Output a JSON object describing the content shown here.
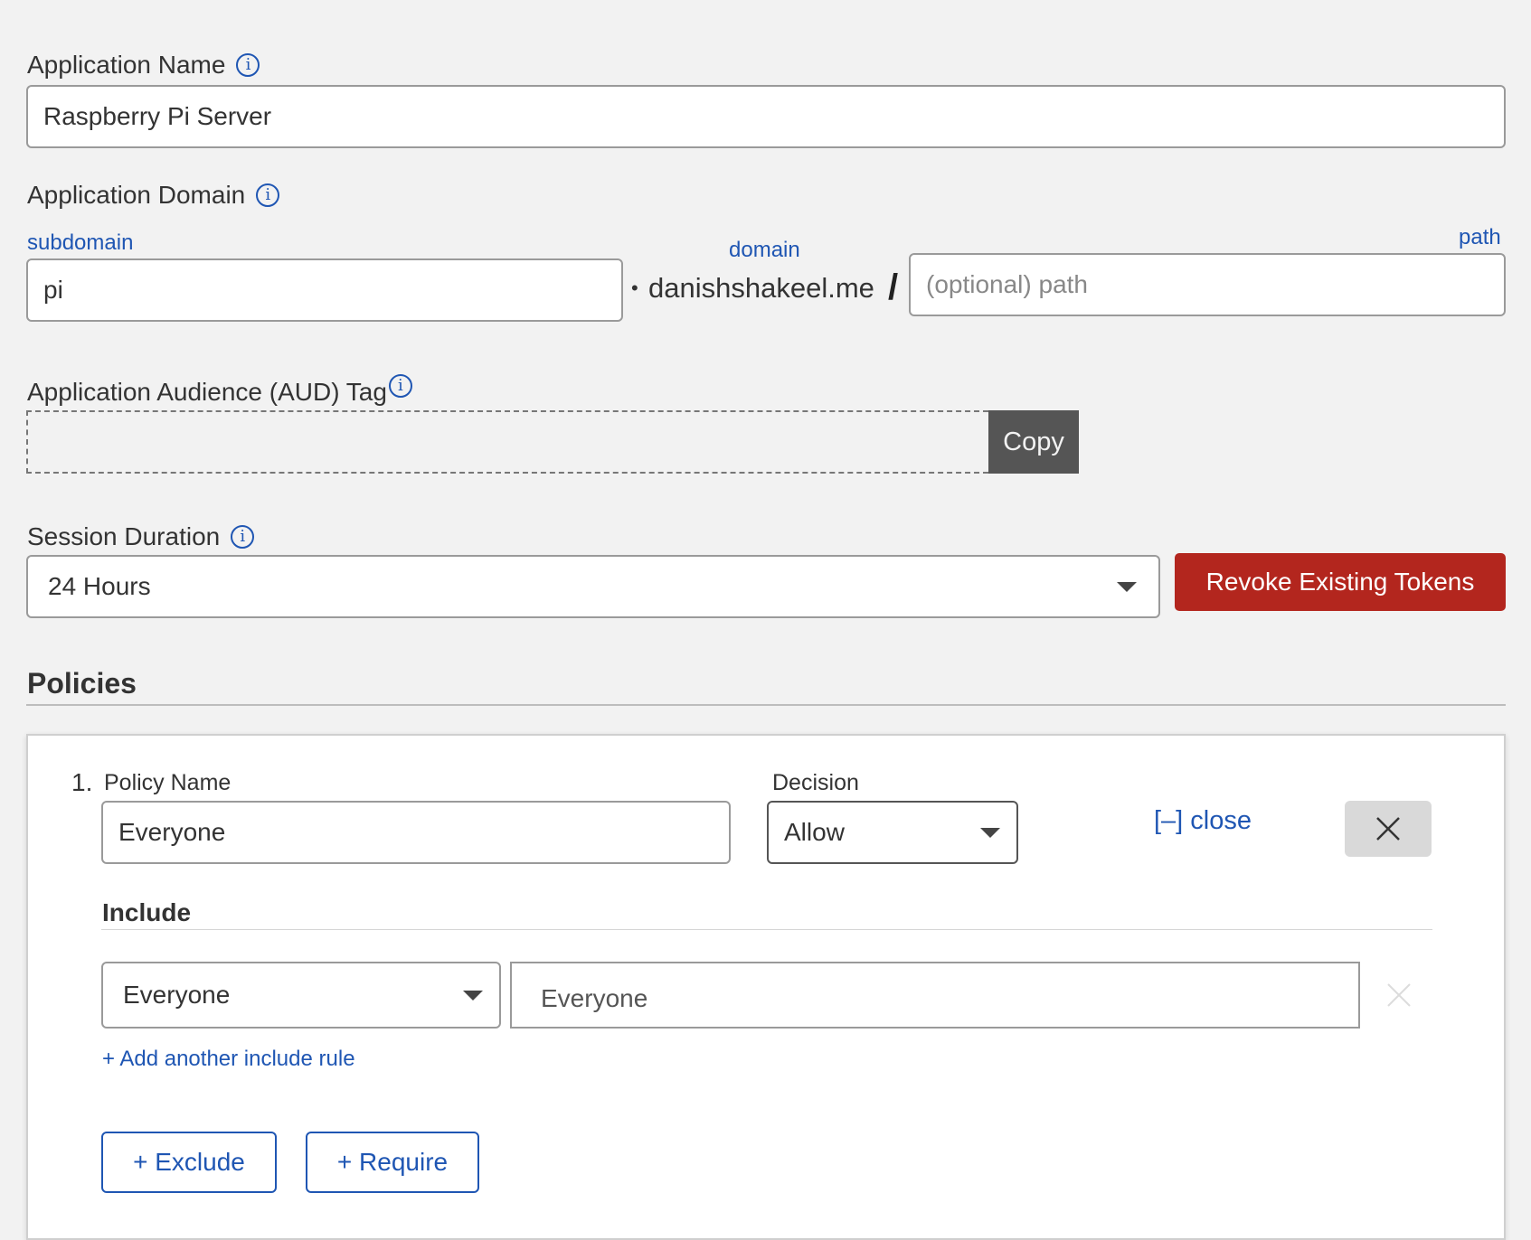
{
  "app_name": {
    "label": "Application Name",
    "value": "Raspberry Pi Server",
    "info_icon": "info-icon"
  },
  "app_domain": {
    "label": "Application Domain",
    "subdomain_label": "subdomain",
    "subdomain_value": "pi",
    "dot": "•",
    "domain_label": "domain",
    "domain_value": "danishshakeel.me",
    "slash": "/",
    "path_label": "path",
    "path_placeholder": "(optional) path"
  },
  "aud_tag": {
    "label": "Application Audience (AUD) Tag",
    "value": "",
    "copy_label": "Copy"
  },
  "session": {
    "label": "Session Duration",
    "value": "24 Hours",
    "revoke_label": "Revoke Existing Tokens",
    "revoke_color": "#b3261e"
  },
  "policies": {
    "heading": "Policies",
    "items": [
      {
        "number": "1.",
        "name_label": "Policy Name",
        "name_value": "Everyone",
        "decision_label": "Decision",
        "decision_value": "Allow",
        "close_label": "[–] close",
        "include_heading": "Include",
        "include_rules": [
          {
            "selector": "Everyone",
            "value": "Everyone"
          }
        ],
        "add_include_label": "+ Add another include rule",
        "exclude_label": "+ Exclude",
        "require_label": "+ Require"
      }
    ]
  },
  "colors": {
    "link_blue": "#1f56b3",
    "copy_bg": "#555555",
    "delete_bg": "#d9d9d9"
  }
}
